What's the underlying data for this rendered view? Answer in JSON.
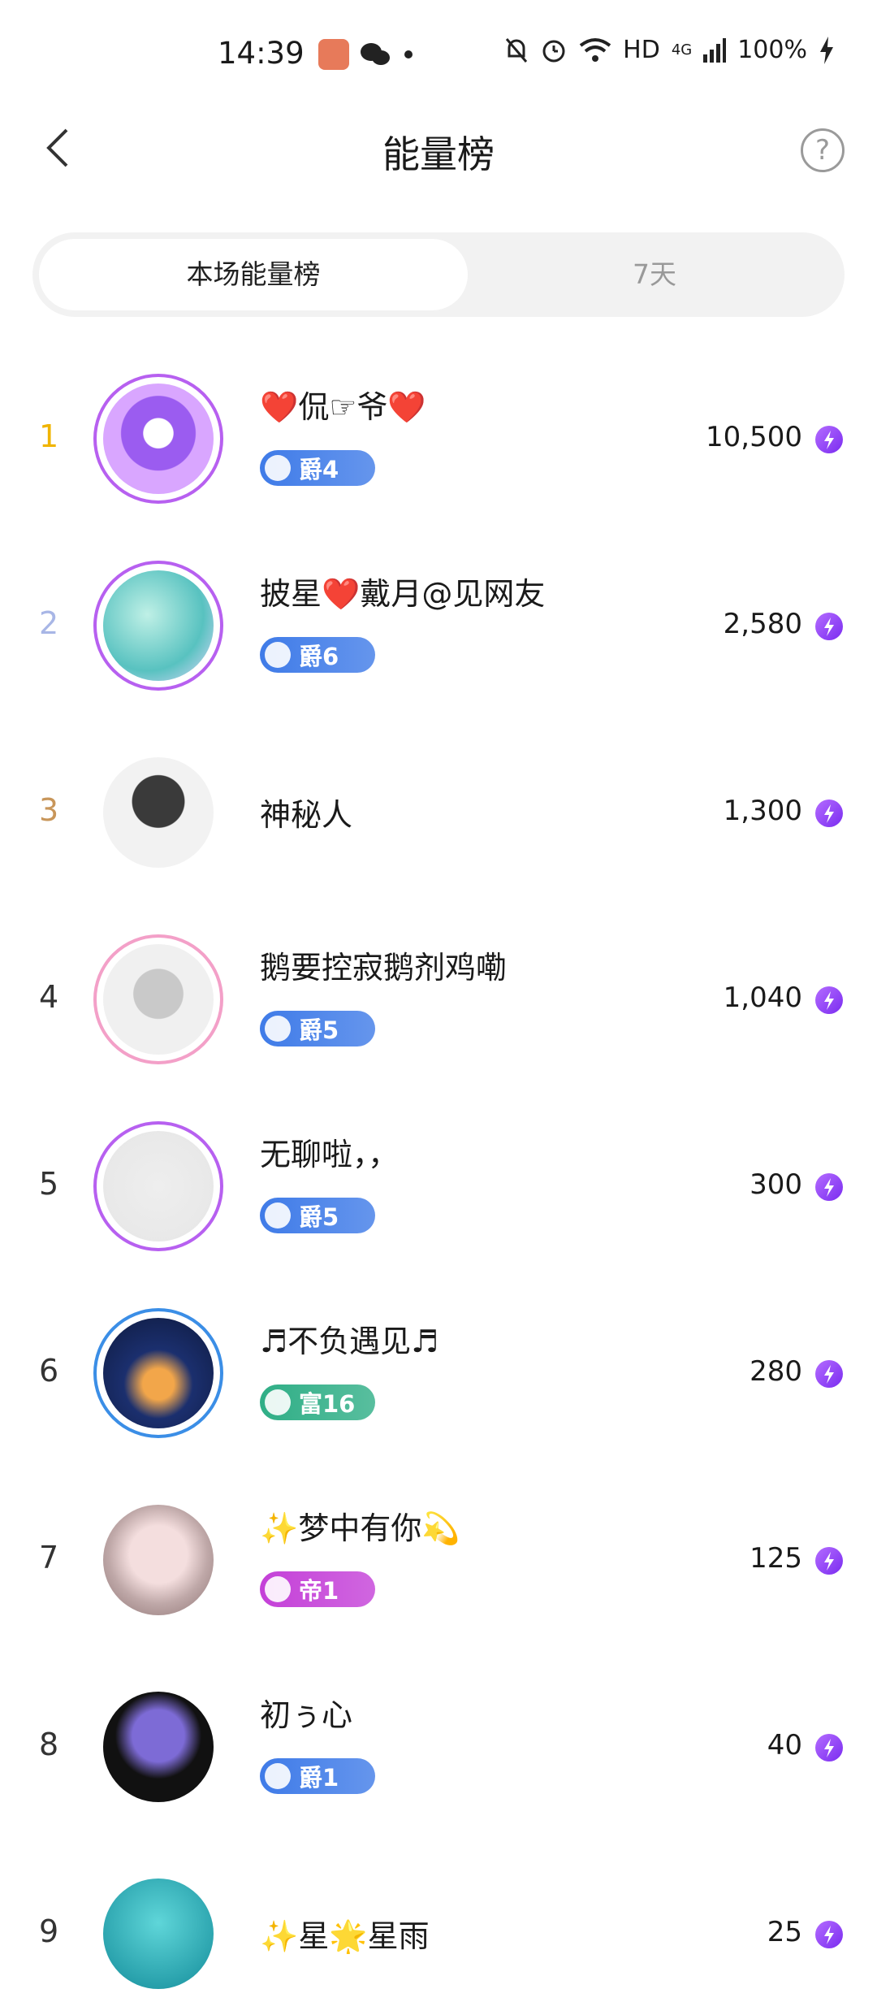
{
  "status_bar": {
    "time": "14:39",
    "network": "HD",
    "signal": "4G",
    "battery": "100%"
  },
  "header": {
    "title": "能量榜",
    "help_label": "?"
  },
  "tabs": [
    {
      "label": "本场能量榜",
      "active": true
    },
    {
      "label": "7天",
      "active": false
    }
  ],
  "entries": [
    {
      "rank": "1",
      "name": "❤️侃☞爷❤️",
      "badge": "爵4",
      "score": "10,500",
      "rank_color": "#f0b400",
      "badge_color": "#3f7be8",
      "frame_color": "#b760f0"
    },
    {
      "rank": "2",
      "name": "披星❤️戴月@见网友",
      "badge": "爵6",
      "score": "2,580",
      "rank_color": "#a8b6e6",
      "badge_color": "#3f7be8",
      "frame_color": "#b760f0"
    },
    {
      "rank": "3",
      "name": "神秘人",
      "badge": "",
      "score": "1,300",
      "rank_color": "#c8965a",
      "badge_color": "",
      "frame_color": ""
    },
    {
      "rank": "4",
      "name": "鹅要控寂鹅剂鸡嘞",
      "badge": "爵5",
      "score": "1,040",
      "rank_color": "#333333",
      "badge_color": "#3f7be8",
      "frame_color": "#f3a0c8"
    },
    {
      "rank": "5",
      "name": "无聊啦，，",
      "badge": "爵5",
      "score": "300",
      "rank_color": "#333333",
      "badge_color": "#3f7be8",
      "frame_color": "#b760f0"
    },
    {
      "rank": "6",
      "name": "♬不负遇见♬",
      "badge": "富16",
      "score": "280",
      "rank_color": "#333333",
      "badge_color": "#2fae86",
      "frame_color": "#3b8ee6"
    },
    {
      "rank": "7",
      "name": "✨梦中有你💫",
      "badge": "帝1",
      "score": "125",
      "rank_color": "#333333",
      "badge_color": "#c440d8",
      "frame_color": ""
    },
    {
      "rank": "8",
      "name": "初ぅ心",
      "badge": "爵1",
      "score": "40",
      "rank_color": "#333333",
      "badge_color": "#3f7be8",
      "frame_color": ""
    },
    {
      "rank": "9",
      "name": "✨星🌟星雨",
      "badge": "",
      "score": "25",
      "rank_color": "#333333",
      "badge_color": "",
      "frame_color": ""
    }
  ]
}
